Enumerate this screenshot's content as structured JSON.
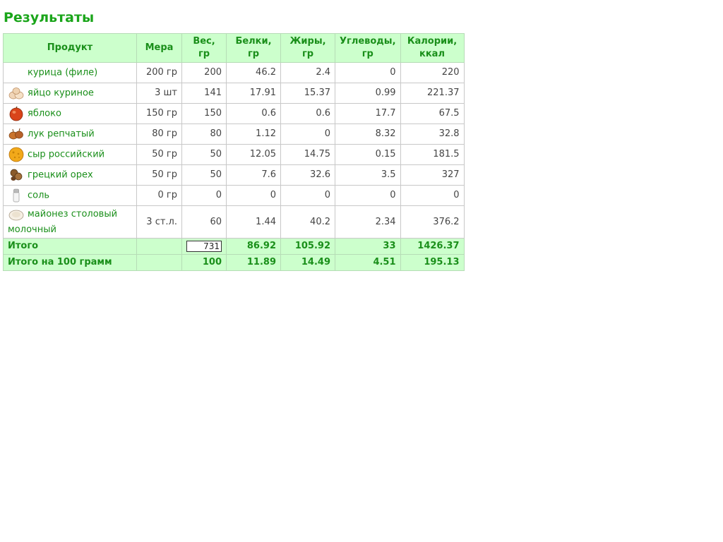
{
  "page_title": "Результаты",
  "columns": [
    "Продукт",
    "Мера",
    "Вес, гр",
    "Белки, гр",
    "Жиры, гр",
    "Углеводы, гр",
    "Калории, ккал"
  ],
  "rows": [
    {
      "icon": "none",
      "name": "курица (филе)",
      "measure": "200 гр",
      "weight": "200",
      "protein": "46.2",
      "fat": "2.4",
      "carbs": "0",
      "kcal": "220"
    },
    {
      "icon": "eggs-icon",
      "name": "яйцо куриное",
      "measure": "3 шт",
      "weight": "141",
      "protein": "17.91",
      "fat": "15.37",
      "carbs": "0.99",
      "kcal": "221.37"
    },
    {
      "icon": "apple-icon",
      "name": "яблоко",
      "measure": "150 гр",
      "weight": "150",
      "protein": "0.6",
      "fat": "0.6",
      "carbs": "17.7",
      "kcal": "67.5"
    },
    {
      "icon": "onion-icon",
      "name": "лук репчатый",
      "measure": "80 гр",
      "weight": "80",
      "protein": "1.12",
      "fat": "0",
      "carbs": "8.32",
      "kcal": "32.8"
    },
    {
      "icon": "cheese-icon",
      "name": "сыр российский",
      "measure": "50 гр",
      "weight": "50",
      "protein": "12.05",
      "fat": "14.75",
      "carbs": "0.15",
      "kcal": "181.5"
    },
    {
      "icon": "walnut-icon",
      "name": "грецкий орех",
      "measure": "50 гр",
      "weight": "50",
      "protein": "7.6",
      "fat": "32.6",
      "carbs": "3.5",
      "kcal": "327"
    },
    {
      "icon": "salt-icon",
      "name": "соль",
      "measure": "0 гр",
      "weight": "0",
      "protein": "0",
      "fat": "0",
      "carbs": "0",
      "kcal": "0"
    },
    {
      "icon": "mayonnaise-icon",
      "name": "майонез столовый молочный",
      "measure": "3 ст.л.",
      "weight": "60",
      "protein": "1.44",
      "fat": "40.2",
      "carbs": "2.34",
      "kcal": "376.2"
    }
  ],
  "total": {
    "label": "Итого",
    "measure": "",
    "weight": "731",
    "protein": "86.92",
    "fat": "105.92",
    "carbs": "33",
    "kcal": "1426.37"
  },
  "per100": {
    "label": "Итого на 100 грамм",
    "measure": "",
    "weight": "100",
    "protein": "11.89",
    "fat": "14.49",
    "carbs": "4.51",
    "kcal": "195.13"
  }
}
